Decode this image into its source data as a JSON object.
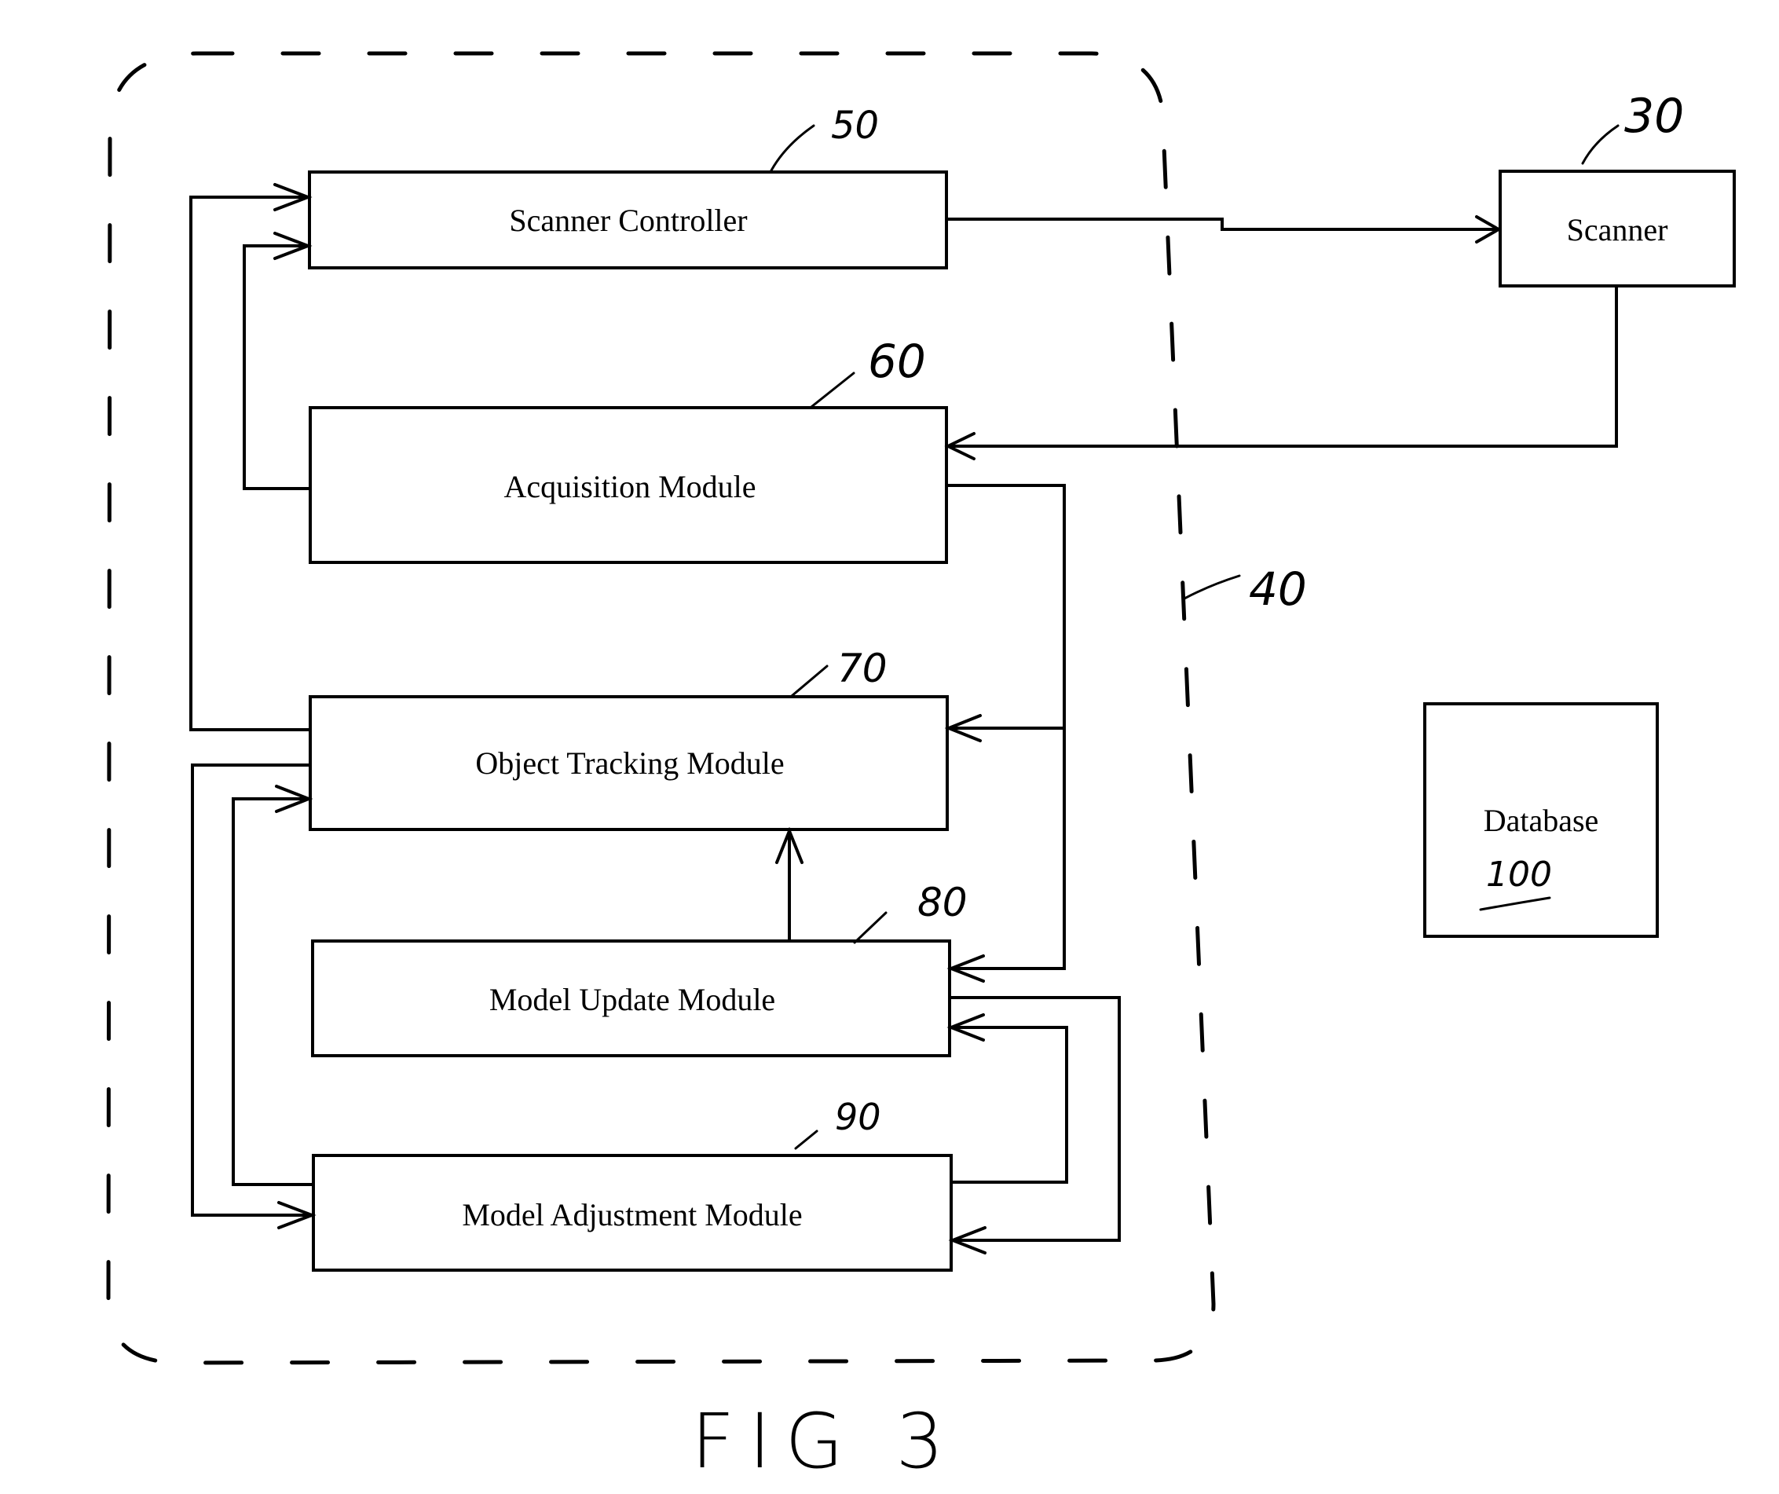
{
  "figure": {
    "caption": "FIG 3"
  },
  "system": {
    "ref": "40"
  },
  "modules": [
    {
      "id": "scanner-controller",
      "label": "Scanner Controller",
      "ref": "50"
    },
    {
      "id": "acquisition-module",
      "label": "Acquisition Module",
      "ref": "60"
    },
    {
      "id": "object-tracking-module",
      "label": "Object Tracking Module",
      "ref": "70"
    },
    {
      "id": "model-update-module",
      "label": "Model Update Module",
      "ref": "80"
    },
    {
      "id": "model-adjustment-module",
      "label": "Model Adjustment Module",
      "ref": "90"
    }
  ],
  "external": [
    {
      "id": "scanner",
      "label": "Scanner",
      "ref": "30"
    },
    {
      "id": "database",
      "label": "Database",
      "ref": "100"
    }
  ],
  "connections": [
    {
      "from": "Scanner Controller",
      "to": "Scanner"
    },
    {
      "from": "Scanner",
      "to": "Acquisition Module"
    },
    {
      "from": "Acquisition Module",
      "to": "Scanner Controller"
    },
    {
      "from": "Acquisition Module",
      "to": "Object Tracking Module"
    },
    {
      "from": "Acquisition Module",
      "to": "Model Update Module"
    },
    {
      "from": "Object Tracking Module",
      "to": "Scanner Controller"
    },
    {
      "from": "Object Tracking Module",
      "to": "Model Adjustment Module"
    },
    {
      "from": "Model Update Module",
      "to": "Object Tracking Module"
    },
    {
      "from": "Model Update Module",
      "to": "Model Adjustment Module"
    },
    {
      "from": "Model Adjustment Module",
      "to": "Object Tracking Module"
    },
    {
      "from": "Model Adjustment Module",
      "to": "Model Update Module"
    }
  ]
}
